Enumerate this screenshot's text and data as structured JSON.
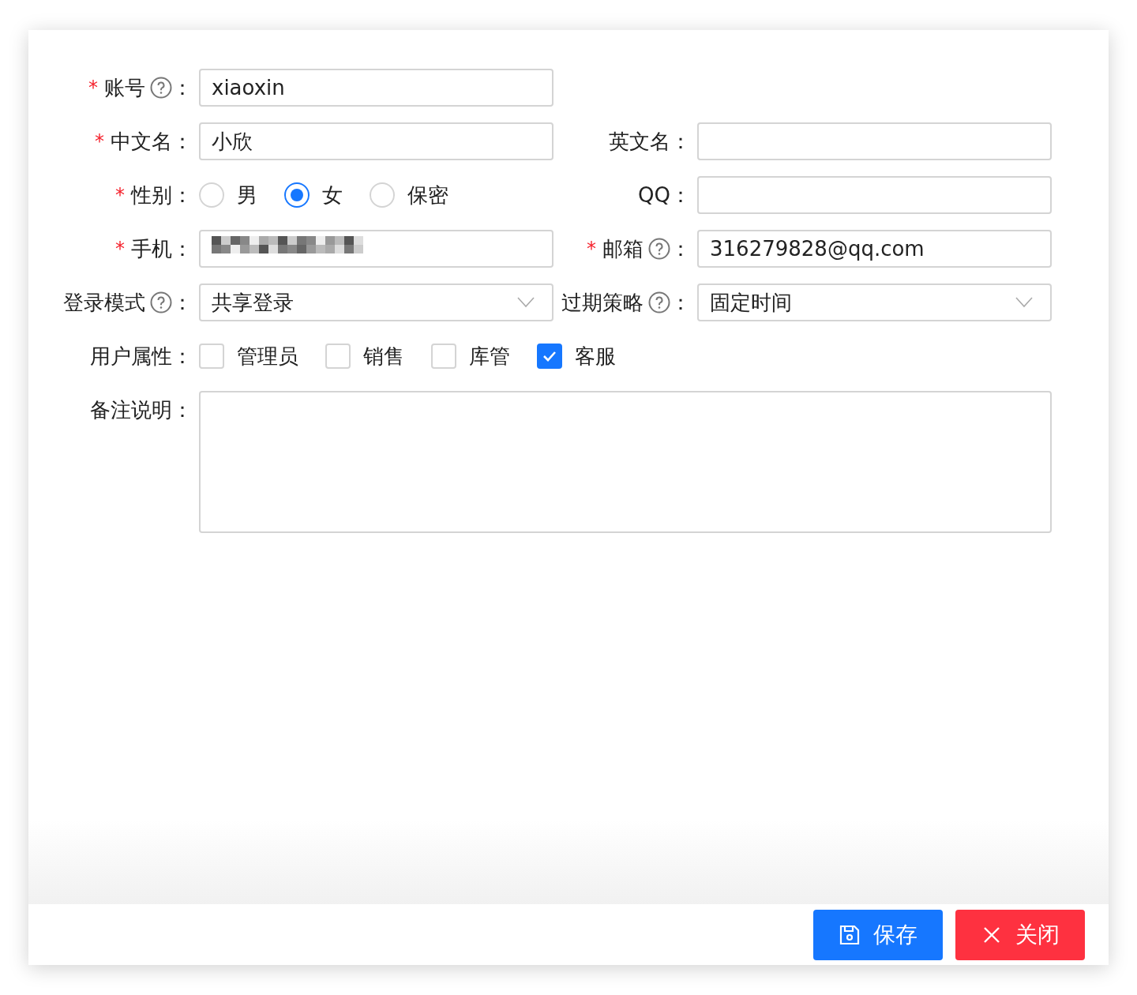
{
  "form": {
    "rows": [
      [
        {
          "kind": "text",
          "mark": "*",
          "label": "账号",
          "colon": "：",
          "help": true,
          "value": "xiaoxin"
        }
      ],
      [
        {
          "kind": "text",
          "mark": "*",
          "label": "中文名",
          "colon": "：",
          "help": false,
          "value": "小欣"
        },
        {
          "kind": "text",
          "label": "英文名",
          "colon": "：",
          "help": false
        }
      ],
      [
        {
          "kind": "radio",
          "mark": "*",
          "label": "性别",
          "colon": "：",
          "help": false,
          "options": [
            {
              "label": "男",
              "selected": false
            },
            {
              "label": "女",
              "selected": true
            },
            {
              "label": "保密",
              "selected": false
            }
          ]
        },
        {
          "kind": "text",
          "label": "QQ",
          "colon": "：",
          "help": false
        }
      ],
      [
        {
          "kind": "text",
          "mark": "*",
          "label": "手机",
          "colon": "：",
          "help": false,
          "redacted": true
        },
        {
          "kind": "text",
          "mark": "*",
          "label": "邮箱",
          "colon": "：",
          "help": true,
          "value": "316279828@qq.com"
        }
      ],
      [
        {
          "kind": "select",
          "label": "登录模式",
          "colon": "：",
          "help": true,
          "value": "共享登录"
        },
        {
          "kind": "select",
          "label": "过期策略",
          "colon": "：",
          "help": true,
          "value": "固定时间"
        }
      ],
      [
        {
          "kind": "checkbox",
          "label": "用户属性",
          "colon": "：",
          "help": false,
          "options": [
            {
              "label": "管理员",
              "checked": false
            },
            {
              "label": "销售",
              "checked": false
            },
            {
              "label": "库管",
              "checked": false
            },
            {
              "label": "客服",
              "checked": true
            }
          ]
        }
      ],
      [
        {
          "kind": "textarea",
          "label": "备注说明",
          "colon": "：",
          "help": false
        }
      ]
    ]
  },
  "buttons": [
    {
      "kind": "primary",
      "label": "保存"
    },
    {
      "kind": "danger",
      "label": "关闭"
    }
  ]
}
